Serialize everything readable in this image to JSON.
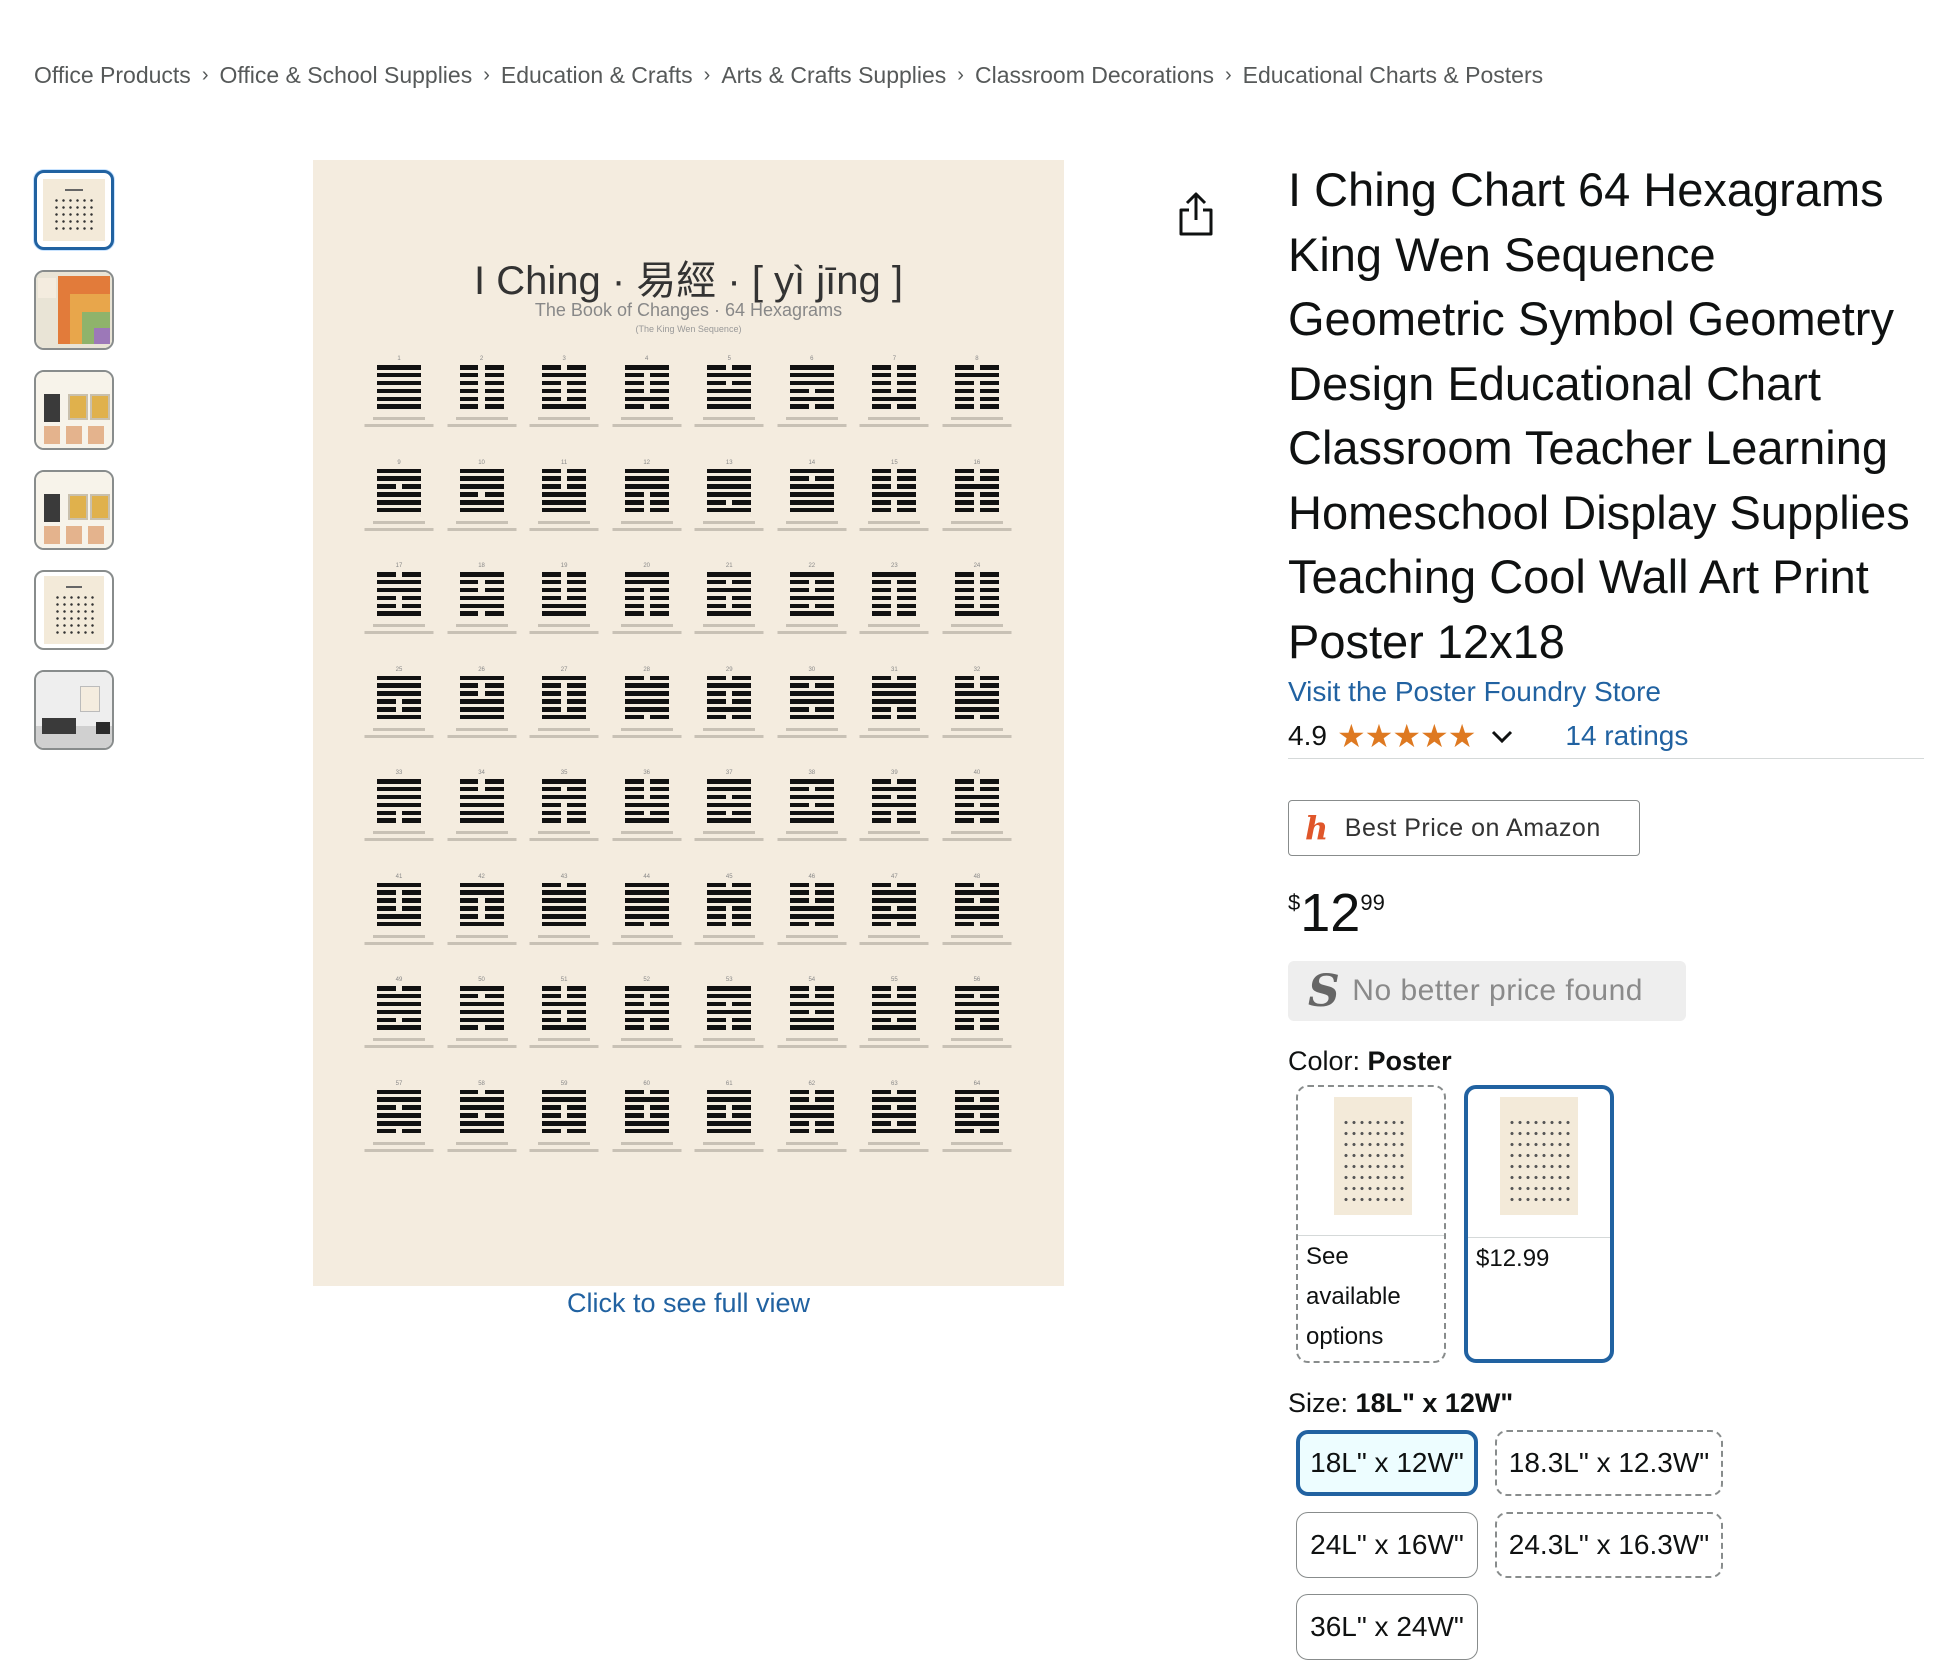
{
  "breadcrumb": [
    "Office Products",
    "Office & School Supplies",
    "Education & Crafts",
    "Arts & Crafts Supplies",
    "Classroom Decorations",
    "Educational Charts & Posters"
  ],
  "breadcrumb_separator": "›",
  "poster": {
    "title": "I Ching · 易經 · [ yì jīng ]",
    "subtitle": "The Book of Changes · 64 Hexagrams",
    "note": "(The King Wen Sequence)"
  },
  "full_view": "Click to see full view",
  "product": {
    "title": "I Ching Chart 64 Hexagrams King Wen Sequence Geometric Symbol Geometry Design Educational Chart Classroom Teacher Learning Homeschool Display Supplies Teaching Cool Wall Art Print Poster 12x18",
    "store": "Visit the Poster Foundry Store",
    "rating": "4.9",
    "stars": "★★★★★",
    "ratings_count": "14 ratings"
  },
  "best_price": {
    "icon": "h",
    "label": "Best Price on Amazon"
  },
  "price": {
    "symbol": "$",
    "whole": "12",
    "fraction": "99"
  },
  "no_better": {
    "icon": "S",
    "label": "No better price found"
  },
  "color": {
    "label": "Color:",
    "value": "Poster",
    "options": [
      {
        "text_lines": [
          "See",
          "available",
          "options"
        ]
      },
      {
        "text_lines": [
          "$12.99"
        ]
      }
    ]
  },
  "size": {
    "label": "Size:",
    "value": "18L\" x 12W\"",
    "options": [
      "18L\" x 12W\"",
      "18.3L\" x 12.3W\"",
      "24L\" x 16W\"",
      "24.3L\" x 16.3W\"",
      "36L\" x 24W\""
    ]
  },
  "icons": {
    "share": "share-icon",
    "chevron": "chevron-down-icon"
  },
  "colors": {
    "link": "#2162a1",
    "star": "#de7921",
    "selected_border": "#2162a1",
    "poster_bg": "#f4ecdf"
  },
  "hexagrams": [
    {
      "n": "1",
      "lines": [
        1,
        1,
        1,
        1,
        1,
        1
      ]
    },
    {
      "n": "2",
      "lines": [
        0,
        0,
        0,
        0,
        0,
        0
      ]
    },
    {
      "n": "3",
      "lines": [
        0,
        1,
        0,
        0,
        0,
        1
      ]
    },
    {
      "n": "4",
      "lines": [
        1,
        0,
        0,
        0,
        1,
        0
      ]
    },
    {
      "n": "5",
      "lines": [
        0,
        1,
        0,
        1,
        1,
        1
      ]
    },
    {
      "n": "6",
      "lines": [
        1,
        1,
        1,
        0,
        1,
        0
      ]
    },
    {
      "n": "7",
      "lines": [
        0,
        0,
        0,
        0,
        1,
        0
      ]
    },
    {
      "n": "8",
      "lines": [
        0,
        1,
        0,
        0,
        0,
        0
      ]
    },
    {
      "n": "9",
      "lines": [
        1,
        1,
        0,
        1,
        1,
        1
      ]
    },
    {
      "n": "10",
      "lines": [
        1,
        1,
        1,
        0,
        1,
        1
      ]
    },
    {
      "n": "11",
      "lines": [
        0,
        0,
        0,
        1,
        1,
        1
      ]
    },
    {
      "n": "12",
      "lines": [
        1,
        1,
        1,
        0,
        0,
        0
      ]
    },
    {
      "n": "13",
      "lines": [
        1,
        1,
        1,
        1,
        0,
        1
      ]
    },
    {
      "n": "14",
      "lines": [
        1,
        0,
        1,
        1,
        1,
        1
      ]
    },
    {
      "n": "15",
      "lines": [
        0,
        0,
        0,
        1,
        0,
        0
      ]
    },
    {
      "n": "16",
      "lines": [
        0,
        0,
        1,
        0,
        0,
        0
      ]
    },
    {
      "n": "17",
      "lines": [
        0,
        1,
        1,
        0,
        0,
        1
      ]
    },
    {
      "n": "18",
      "lines": [
        1,
        0,
        0,
        1,
        1,
        0
      ]
    },
    {
      "n": "19",
      "lines": [
        0,
        0,
        0,
        0,
        1,
        1
      ]
    },
    {
      "n": "20",
      "lines": [
        1,
        1,
        0,
        0,
        0,
        0
      ]
    },
    {
      "n": "21",
      "lines": [
        1,
        0,
        1,
        0,
        0,
        1
      ]
    },
    {
      "n": "22",
      "lines": [
        1,
        0,
        0,
        1,
        0,
        1
      ]
    },
    {
      "n": "23",
      "lines": [
        1,
        0,
        0,
        0,
        0,
        0
      ]
    },
    {
      "n": "24",
      "lines": [
        0,
        0,
        0,
        0,
        0,
        1
      ]
    },
    {
      "n": "25",
      "lines": [
        1,
        1,
        1,
        0,
        0,
        1
      ]
    },
    {
      "n": "26",
      "lines": [
        1,
        0,
        0,
        1,
        1,
        1
      ]
    },
    {
      "n": "27",
      "lines": [
        1,
        0,
        0,
        0,
        0,
        1
      ]
    },
    {
      "n": "28",
      "lines": [
        0,
        1,
        1,
        1,
        1,
        0
      ]
    },
    {
      "n": "29",
      "lines": [
        0,
        1,
        0,
        0,
        1,
        0
      ]
    },
    {
      "n": "30",
      "lines": [
        1,
        0,
        1,
        1,
        0,
        1
      ]
    },
    {
      "n": "31",
      "lines": [
        0,
        1,
        1,
        1,
        0,
        0
      ]
    },
    {
      "n": "32",
      "lines": [
        0,
        0,
        1,
        1,
        1,
        0
      ]
    },
    {
      "n": "33",
      "lines": [
        1,
        1,
        1,
        1,
        0,
        0
      ]
    },
    {
      "n": "34",
      "lines": [
        0,
        0,
        1,
        1,
        1,
        1
      ]
    },
    {
      "n": "35",
      "lines": [
        1,
        0,
        1,
        0,
        0,
        0
      ]
    },
    {
      "n": "36",
      "lines": [
        0,
        0,
        0,
        1,
        0,
        1
      ]
    },
    {
      "n": "37",
      "lines": [
        1,
        1,
        0,
        1,
        0,
        1
      ]
    },
    {
      "n": "38",
      "lines": [
        1,
        0,
        1,
        0,
        1,
        1
      ]
    },
    {
      "n": "39",
      "lines": [
        0,
        1,
        0,
        1,
        0,
        0
      ]
    },
    {
      "n": "40",
      "lines": [
        0,
        0,
        1,
        0,
        1,
        0
      ]
    },
    {
      "n": "41",
      "lines": [
        1,
        0,
        0,
        0,
        1,
        1
      ]
    },
    {
      "n": "42",
      "lines": [
        1,
        1,
        0,
        0,
        0,
        1
      ]
    },
    {
      "n": "43",
      "lines": [
        0,
        1,
        1,
        1,
        1,
        1
      ]
    },
    {
      "n": "44",
      "lines": [
        1,
        1,
        1,
        1,
        1,
        0
      ]
    },
    {
      "n": "45",
      "lines": [
        0,
        1,
        1,
        0,
        0,
        0
      ]
    },
    {
      "n": "46",
      "lines": [
        0,
        0,
        0,
        1,
        1,
        0
      ]
    },
    {
      "n": "47",
      "lines": [
        0,
        1,
        1,
        0,
        1,
        0
      ]
    },
    {
      "n": "48",
      "lines": [
        0,
        1,
        0,
        1,
        1,
        0
      ]
    },
    {
      "n": "49",
      "lines": [
        0,
        1,
        1,
        1,
        0,
        1
      ]
    },
    {
      "n": "50",
      "lines": [
        1,
        0,
        1,
        1,
        1,
        0
      ]
    },
    {
      "n": "51",
      "lines": [
        0,
        0,
        1,
        0,
        0,
        1
      ]
    },
    {
      "n": "52",
      "lines": [
        1,
        0,
        0,
        1,
        0,
        0
      ]
    },
    {
      "n": "53",
      "lines": [
        1,
        1,
        0,
        1,
        0,
        0
      ]
    },
    {
      "n": "54",
      "lines": [
        0,
        0,
        1,
        0,
        1,
        1
      ]
    },
    {
      "n": "55",
      "lines": [
        0,
        0,
        1,
        1,
        0,
        1
      ]
    },
    {
      "n": "56",
      "lines": [
        1,
        0,
        1,
        1,
        0,
        0
      ]
    },
    {
      "n": "57",
      "lines": [
        1,
        1,
        0,
        1,
        1,
        0
      ]
    },
    {
      "n": "58",
      "lines": [
        0,
        1,
        1,
        0,
        1,
        1
      ]
    },
    {
      "n": "59",
      "lines": [
        1,
        1,
        0,
        0,
        1,
        0
      ]
    },
    {
      "n": "60",
      "lines": [
        0,
        1,
        0,
        0,
        1,
        1
      ]
    },
    {
      "n": "61",
      "lines": [
        1,
        1,
        0,
        0,
        1,
        1
      ]
    },
    {
      "n": "62",
      "lines": [
        0,
        0,
        1,
        1,
        0,
        0
      ]
    },
    {
      "n": "63",
      "lines": [
        0,
        1,
        0,
        1,
        0,
        1
      ]
    },
    {
      "n": "64",
      "lines": [
        1,
        0,
        1,
        0,
        1,
        0
      ]
    }
  ]
}
